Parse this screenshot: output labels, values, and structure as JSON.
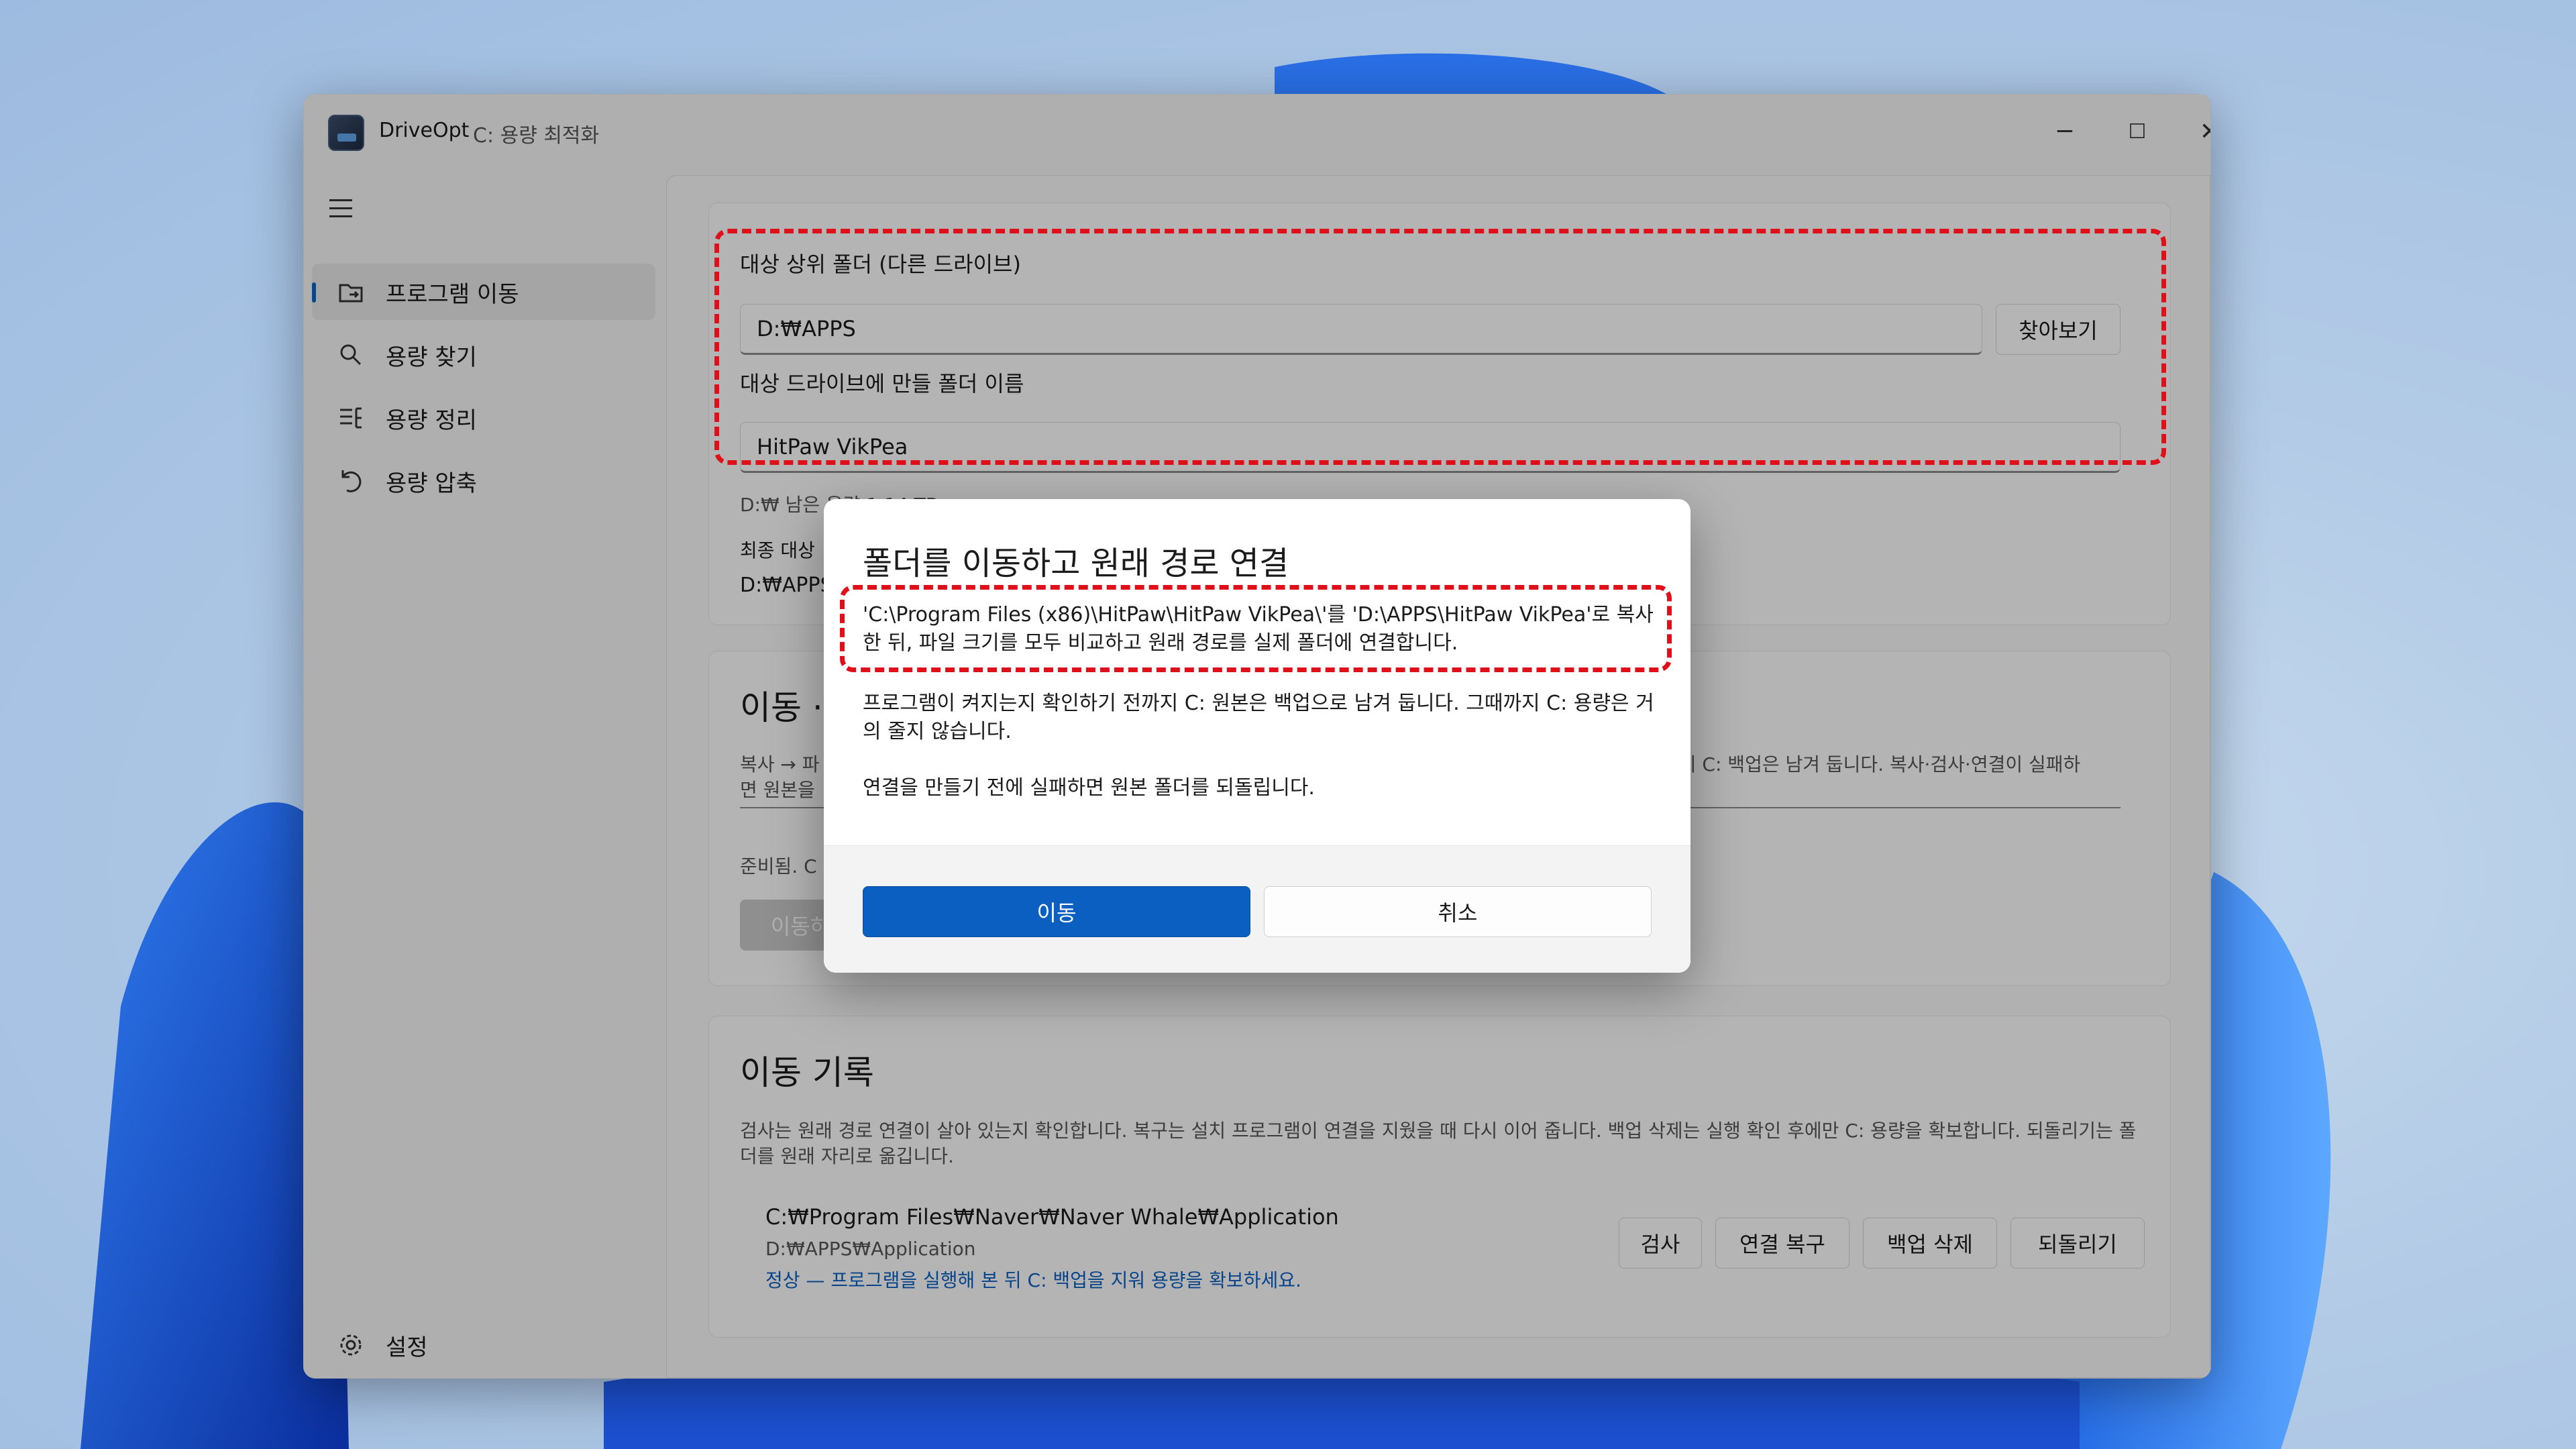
{
  "window": {
    "app_name": "DriveOpt",
    "subtitle": "C: 용량 최적화",
    "controls": {
      "minimize": "─",
      "maximize": "☐",
      "close": "✕"
    }
  },
  "nav": {
    "items": [
      {
        "label": "프로그램 이동",
        "icon": "folder-move-icon",
        "active": true
      },
      {
        "label": "용량 찾기",
        "icon": "search-icon"
      },
      {
        "label": "용량 정리",
        "icon": "list-clean-icon"
      },
      {
        "label": "용량 압축",
        "icon": "undo-compress-icon"
      }
    ],
    "settings_label": "설정"
  },
  "target_card": {
    "parent_folder_label": "대상 상위 폴더 (다른 드라이브)",
    "parent_folder_value": "D:₩APPS",
    "browse_label": "찾아보기",
    "folder_name_label": "대상 드라이브에 만들 폴더 이름",
    "folder_name_value": "HitPaw VikPea",
    "free_space": "D:₩ 남은 용량 1.14 TB",
    "final_label": "최종 대상",
    "final_value": "D:₩APPS"
  },
  "move_card": {
    "title": "이동 ·",
    "desc_left_1": "복사 → 파",
    "desc_left_2": "면 원본을",
    "desc_right": "까지 C: 백업은 남겨 둡니다. 복사·검사·연결이 실패하",
    "status": "준비됨. C",
    "button": "이동하"
  },
  "history": {
    "title": "이동 기록",
    "description_1": "검사는 원래 경로 연결이 살아 있는지 확인합니다. 복구는 설치 프로그램이 연결을 지웠을 때 다시 이어 줍니다. 백업 삭제는 실행 확인 후에만 C: 용량을 확보합니다. 되돌리기는 폴더를 원래 자리로 옮깁니다.",
    "entry": {
      "source": "C:₩Program Files₩Naver₩Naver Whale₩Application",
      "dest": "D:₩APPS₩Application",
      "status": "정상 — 프로그램을 실행해 본 뒤 C: 백업을 지워 용량을 확보하세요."
    },
    "buttons": {
      "check": "검사",
      "repair": "연결 복구",
      "delete_backup": "백업 삭제",
      "revert": "되돌리기"
    }
  },
  "dialog": {
    "title": "폴더를 이동하고 원래 경로 연결",
    "message_1": "'C:\\Program Files (x86)\\HitPaw\\HitPaw VikPea\\'를 'D:\\APPS\\HitPaw VikPea'로 복사한 뒤, 파일 크기를 모두 비교하고 원래 경로를 실제 폴더에 연결합니다.",
    "message_2": "프로그램이 켜지는지 확인하기 전까지 C: 원본은 백업으로 남겨 둡니다. 그때까지 C: 용량은 거의 줄지 않습니다.",
    "message_3": "연결을 만들기 전에 실패하면 원본 폴더를 되돌립니다.",
    "confirm_label": "이동",
    "cancel_label": "취소"
  },
  "colors": {
    "accent": "#0a5fc0",
    "highlight": "#e0101a",
    "link": "#0a5fc0"
  }
}
